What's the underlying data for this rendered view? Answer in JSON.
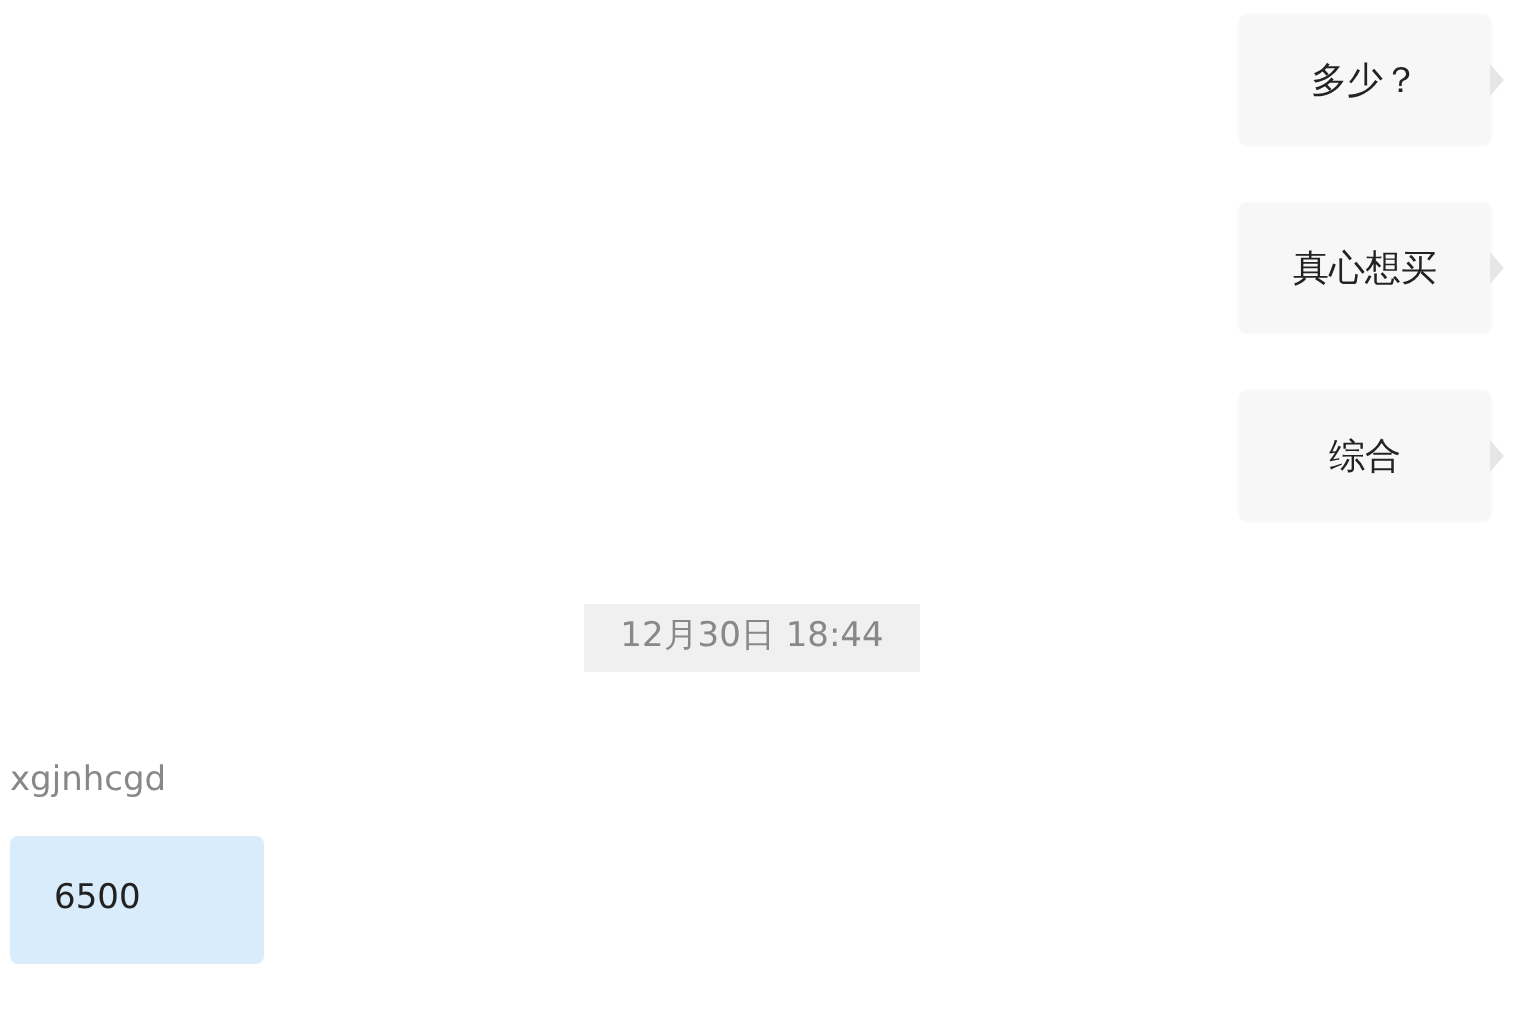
{
  "messages": [
    {
      "kind": "sent",
      "text": "多少？"
    },
    {
      "kind": "sent",
      "text": "真心想买"
    },
    {
      "kind": "sent",
      "text": "综合"
    },
    {
      "kind": "timestamp",
      "text": "12月30日 18:44"
    },
    {
      "kind": "received",
      "sender": "xgjnhcgd",
      "text": "6500"
    }
  ]
}
